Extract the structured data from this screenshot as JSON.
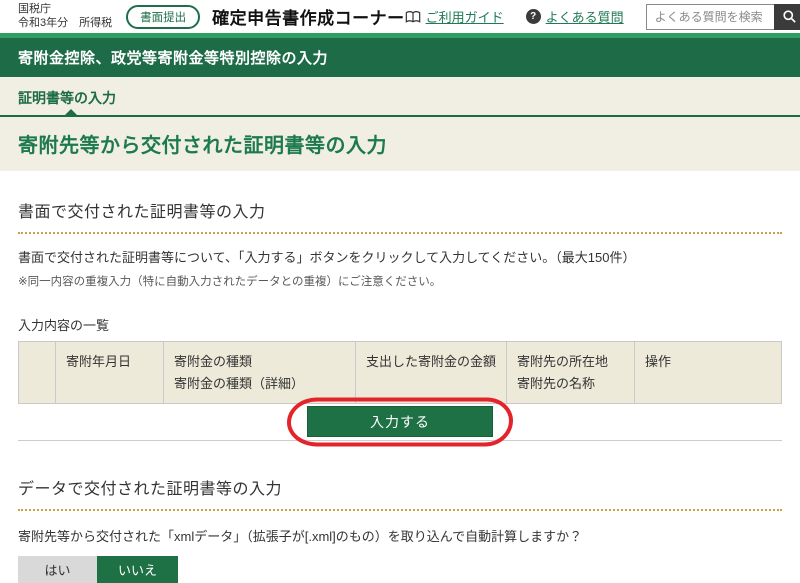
{
  "header": {
    "agency": "国税庁",
    "year_tax": "令和3年分　所得税",
    "badge": "書面提出",
    "app_title": "確定申告書作成コーナー",
    "guide_link": "ご利用ガイド",
    "faq_link": "よくある質問",
    "search_placeholder": "よくある質問を検索",
    "guide_icon": "book-icon",
    "faq_icon": "question-circle-icon",
    "search_icon": "magnifier-icon"
  },
  "banner": {
    "title": "寄附金控除、政党等寄附金等特別控除の入力"
  },
  "step": {
    "label": "証明書等の入力"
  },
  "page_title": "寄附先等から交付された証明書等の入力",
  "paper_section": {
    "heading": "書面で交付された証明書等の入力",
    "instruction": "書面で交付された証明書等について、「入力する」ボタンをクリックして入力してください。（最大150件）",
    "note": "※同一内容の重複入力（特に自動入力されたデータとの重複）にご注意ください。",
    "table": {
      "label": "入力内容の一覧",
      "columns": [
        {
          "lines": [
            ""
          ]
        },
        {
          "lines": [
            "寄附年月日"
          ]
        },
        {
          "lines": [
            "寄附金の種類",
            "寄附金の種類（詳細）"
          ]
        },
        {
          "lines": [
            "支出した寄附金の金額"
          ]
        },
        {
          "lines": [
            "寄附先の所在地",
            "寄附先の名称"
          ]
        },
        {
          "lines": [
            "操作"
          ]
        }
      ],
      "rows": []
    },
    "input_button": "入力する"
  },
  "data_section": {
    "heading": "データで交付された証明書等の入力",
    "question": "寄附先等から交付された「xmlデータ」（拡張子が[.xml]のもの）を取り込んで自動計算しますか？",
    "yes_label": "はい",
    "no_label": "いいえ",
    "selected": "いいえ"
  },
  "colors": {
    "banner_green": "#1d6b47",
    "strip_green": "#2f9e62",
    "button_green": "#1e7145",
    "link_green": "#1f7a55",
    "beige_bg": "#f1efe3",
    "table_header_bg": "#edead9",
    "dotted_rule": "#c79f46",
    "annotation_red": "#e3242b",
    "toggle_gray": "#d9d9d9"
  }
}
